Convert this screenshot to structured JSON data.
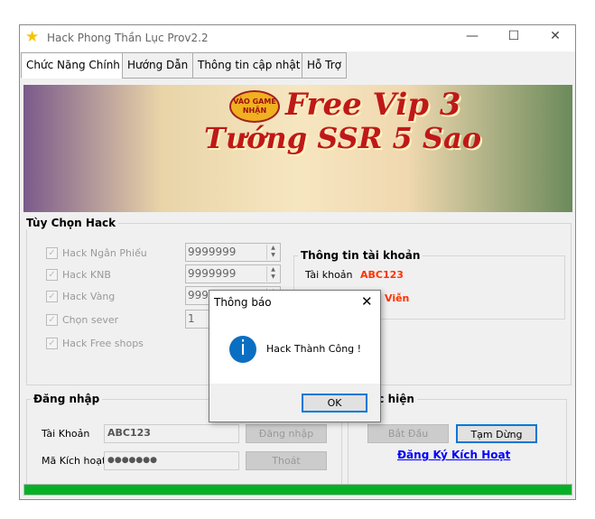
{
  "window": {
    "title": "Hack Phong Thần Lục  Prov2.2",
    "icon": "star-icon",
    "controls": [
      "minimize",
      "maximize",
      "close"
    ]
  },
  "tabs": [
    {
      "label": "Chức Năng Chính",
      "active": true
    },
    {
      "label": "Hướng Dẫn"
    },
    {
      "label": "Thông tin cập nhật"
    },
    {
      "label": "Hỗ Trợ"
    }
  ],
  "banner": {
    "badge": "VÀO GAME NHẬN",
    "line1": "Free Vip 3",
    "line2": "Tướng SSR 5 Sao"
  },
  "hack_options": {
    "title": "Tùy Chọn Hack",
    "items": [
      {
        "label": "Hack Ngân Phiếu",
        "checked": true,
        "value": "9999999"
      },
      {
        "label": "Hack KNB",
        "checked": true,
        "value": "9999999"
      },
      {
        "label": "Hack Vàng",
        "checked": true,
        "value": "9999999"
      },
      {
        "label": "Chọn sever",
        "checked": true,
        "value": "1"
      },
      {
        "label": "Hack Free shops",
        "checked": true
      }
    ]
  },
  "account_info": {
    "title": "Thông tin tài khoản",
    "account_label": "Tài khoản",
    "account_value": "ABC123",
    "expiry_value": "Viễn"
  },
  "login": {
    "title": "Đăng nhập",
    "user_label": "Tài Khoản",
    "user_value": "ABC123",
    "code_label": "Mã Kích hoạt",
    "code_value": "●●●●●●●",
    "login_button": "Đăng nhập",
    "exit_button": "Thoát"
  },
  "execute": {
    "title": "Thực hiện",
    "start_button": "Bắt Đầu",
    "pause_button": "Tạm Dừng",
    "register_link": "Đăng Ký Kích Hoạt"
  },
  "progress": {
    "percent": 100,
    "color": "#06b025"
  },
  "dialog": {
    "title": "Thông báo",
    "message": "Hack Thành Công !",
    "ok": "OK",
    "icon": "info-icon"
  },
  "colors": {
    "accent": "#0078d7",
    "value_red": "#ff3300",
    "link": "#0000ff"
  }
}
